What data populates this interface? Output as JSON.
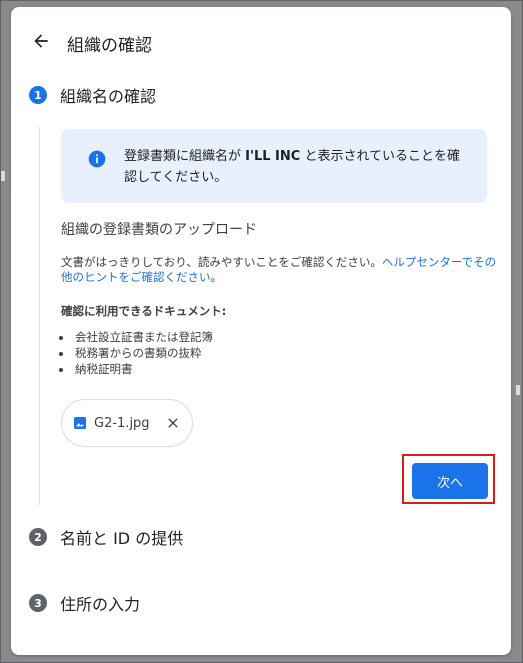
{
  "dialog": {
    "title": "組織の確認",
    "back_icon": "arrow-back-icon"
  },
  "steps": [
    {
      "number": "1",
      "label": "組織名の確認",
      "state": "active",
      "color": "#1a73e8"
    },
    {
      "number": "2",
      "label": "名前と ID の提供",
      "state": "pending",
      "color": "#5f6368"
    },
    {
      "number": "3",
      "label": "住所の入力",
      "state": "pending",
      "color": "#5f6368"
    }
  ],
  "info": {
    "icon": "info-icon",
    "text_before": "登録書類に組織名が ",
    "org_name": "I'LL INC",
    "text_after": " と表示されていることを確認してください。"
  },
  "upload": {
    "title": "組織の登録書類のアップロード",
    "description": "文書がはっきりしており、読みやすいことをご確認ください。",
    "help_link": "ヘルプセンターでその他のヒントをご確認ください",
    "description_end": "。",
    "docs_title": "確認に利用できるドキュメント:",
    "documents": [
      "会社設立証書または登記簿",
      "税務署からの書類の抜粋",
      "納税証明書"
    ],
    "file": {
      "name": "G2-1.jpg",
      "icon": "image-file-icon",
      "remove_icon": "close-icon"
    }
  },
  "actions": {
    "next_label": "次へ",
    "accent": "#1a73e8",
    "highlight_color": "#d81b1b"
  }
}
